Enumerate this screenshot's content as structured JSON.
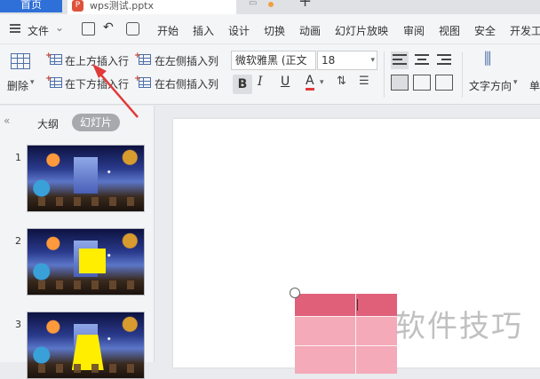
{
  "tabs": {
    "home": "首页",
    "document": "wps测试.pptx"
  },
  "menu": {
    "file": "文件",
    "items": [
      "开始",
      "插入",
      "设计",
      "切换",
      "动画",
      "幻灯片放映",
      "审阅",
      "视图",
      "安全",
      "开发工"
    ]
  },
  "ribbon": {
    "delete": "删除",
    "insert_row_above": "在上方插入行",
    "insert_row_below": "在下方插入行",
    "insert_col_left": "在左侧插入列",
    "insert_col_right": "在右侧插入列",
    "font_name": "微软雅黑 (正文",
    "font_size": "18",
    "text_direction": "文字方向",
    "cut_off": "单"
  },
  "panel": {
    "outline_tab": "大纲",
    "slides_tab": "幻灯片",
    "slide_numbers": [
      "1",
      "2",
      "3"
    ]
  },
  "watermark": "软件技巧",
  "colors": {
    "home_tab": "#2f6fd8",
    "table_header": "#e0607a",
    "table_body": "#f4aab8",
    "arrow": "#e03a3a"
  }
}
